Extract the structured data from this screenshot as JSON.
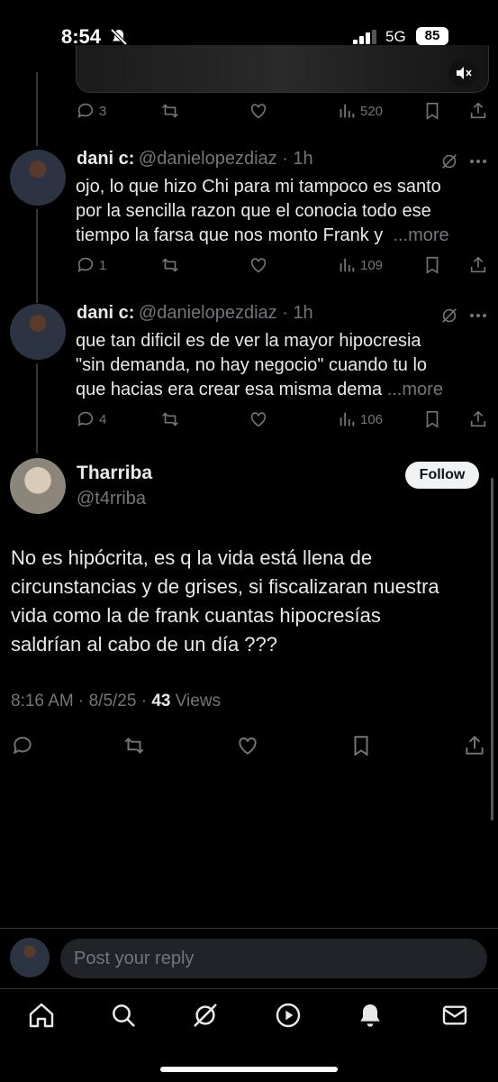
{
  "status": {
    "time": "8:54",
    "network": "5G",
    "battery": "85"
  },
  "top_tweet": {
    "replies": "3",
    "views": "520"
  },
  "replies": [
    {
      "name": "dani c:",
      "handle": "@danielopezdiaz",
      "time": "1h",
      "lines": [
        "ojo, lo que hizo Chi para mi tampoco es santo",
        "por la sencilla razon que el conocia todo ese",
        "tiempo la farsa que nos monto Frank y"
      ],
      "more": "...more",
      "replies": "1",
      "views": "109"
    },
    {
      "name": "dani c:",
      "handle": "@danielopezdiaz",
      "time": "1h",
      "lines": [
        "que tan dificil es de ver la mayor hipocresia",
        "\"sin demanda, no hay negocio\" cuando tu lo",
        "que hacias era crear esa misma dema"
      ],
      "more": "...more",
      "replies": "4",
      "views": "106"
    }
  ],
  "main_tweet": {
    "name": "Tharriba",
    "handle": "@t4rriba",
    "follow_label": "Follow",
    "lines": [
      "No es hipócrita, es q la vida está llena de",
      "circunstancias y de grises, si fiscalizaran nuestra",
      "vida como la de frank cuantas hipocresías",
      "saldrían al cabo de un día ???"
    ],
    "timestamp": "8:16 AM · 8/5/25 · ",
    "views_count": "43",
    "views_label": " Views"
  },
  "reply_box": {
    "placeholder": "Post your reply"
  },
  "tabs": [
    "home-icon",
    "search-icon",
    "grok-icon",
    "video-icon",
    "notifications-icon",
    "messages-icon"
  ],
  "colors": {
    "background": "#000000",
    "text": "#e7e9ea",
    "muted": "#71767b",
    "divider": "#2f3336",
    "follow_bg": "#eff3f4"
  }
}
